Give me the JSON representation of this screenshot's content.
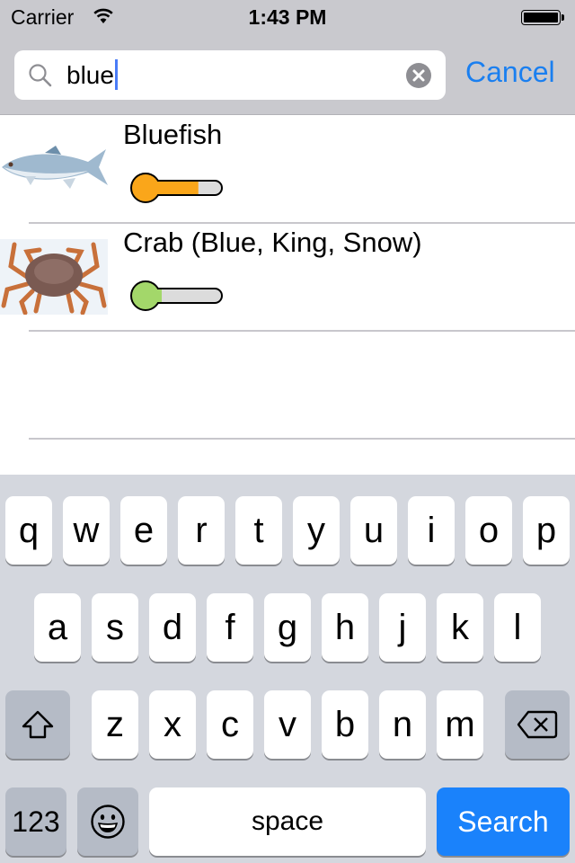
{
  "status_bar": {
    "carrier": "Carrier",
    "time": "1:43 PM",
    "battery_level": 1.0,
    "wifi_icon": "wifi-icon",
    "battery_icon": "battery-icon"
  },
  "search": {
    "value": "blue",
    "search_icon": "search-icon",
    "clear_icon": "clear-icon",
    "cancel_label": "Cancel"
  },
  "results": [
    {
      "title": "Bluefish",
      "image": "bluefish-thumbnail",
      "meter_color": "#faa61a",
      "meter_level": 0.74
    },
    {
      "title": "Crab (Blue, King, Snow)",
      "image": "crab-thumbnail",
      "meter_color": "#a3d76a",
      "meter_level": 0.33
    }
  ],
  "keyboard": {
    "row1": [
      "q",
      "w",
      "e",
      "r",
      "t",
      "y",
      "u",
      "i",
      "o",
      "p"
    ],
    "row2": [
      "a",
      "s",
      "d",
      "f",
      "g",
      "h",
      "j",
      "k",
      "l"
    ],
    "row3": [
      "z",
      "x",
      "c",
      "v",
      "b",
      "n",
      "m"
    ],
    "shift_icon": "shift-icon",
    "delete_icon": "delete-icon",
    "numbers_label": "123",
    "emoji_icon": "emoji-icon",
    "space_label": "space",
    "return_label": "Search"
  },
  "colors": {
    "accent": "#1a7ff0",
    "search_key": "#1a82fb",
    "meter_track": "#dcdcdc"
  }
}
